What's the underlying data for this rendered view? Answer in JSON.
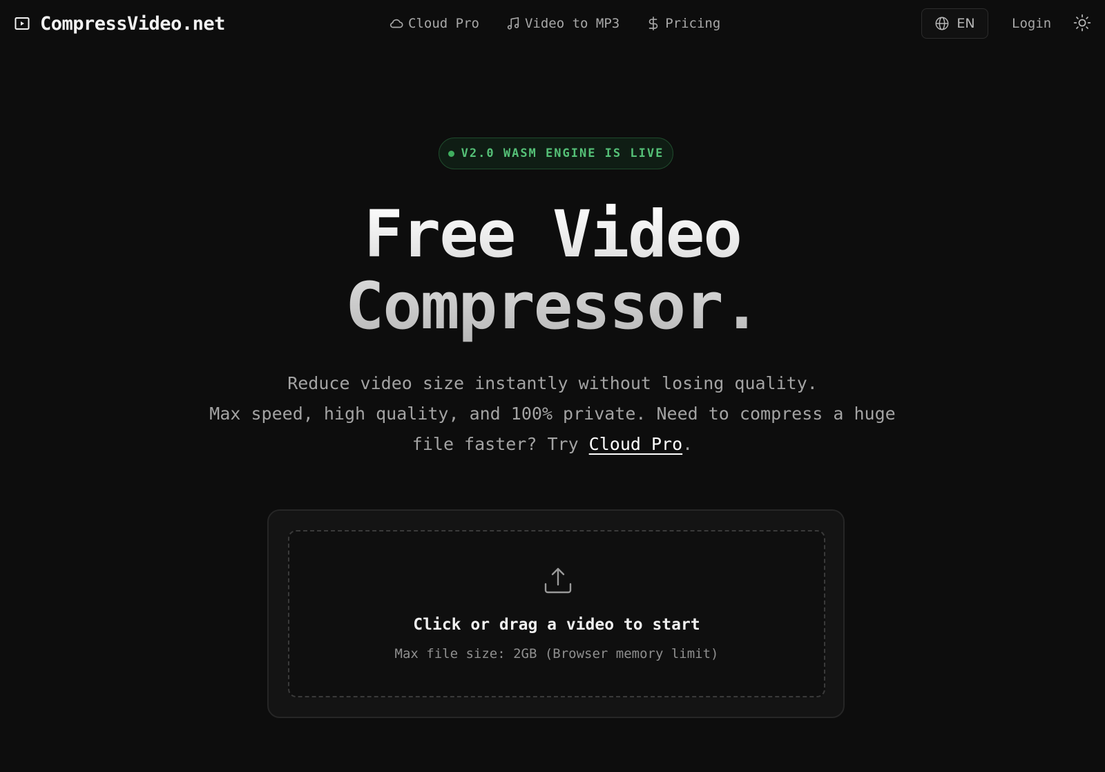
{
  "header": {
    "brand": "CompressVideo.net",
    "nav": [
      {
        "label": "Cloud Pro",
        "icon": "cloud-icon"
      },
      {
        "label": "Video to MP3",
        "icon": "music-note-icon"
      },
      {
        "label": "Pricing",
        "icon": "dollar-icon"
      }
    ],
    "language": "EN",
    "login": "Login"
  },
  "badge": {
    "text": "V2.0 WASM ENGINE IS LIVE"
  },
  "hero": {
    "title_line1": "Free Video",
    "title_line2": "Compressor.",
    "subtitle_line1": "Reduce video size instantly without losing quality.",
    "subtitle_line2_prefix": "Max speed, high quality, and 100% private. Need to compress a huge file faster? Try ",
    "subtitle_link": "Cloud Pro",
    "subtitle_suffix": "."
  },
  "upload": {
    "title": "Click or drag a video to start",
    "subtitle": "Max file size: 2GB (Browser memory limit)"
  },
  "colors": {
    "background": "#0d0d0d",
    "accent_green": "#55c077",
    "text_muted": "#a3a3a3"
  }
}
